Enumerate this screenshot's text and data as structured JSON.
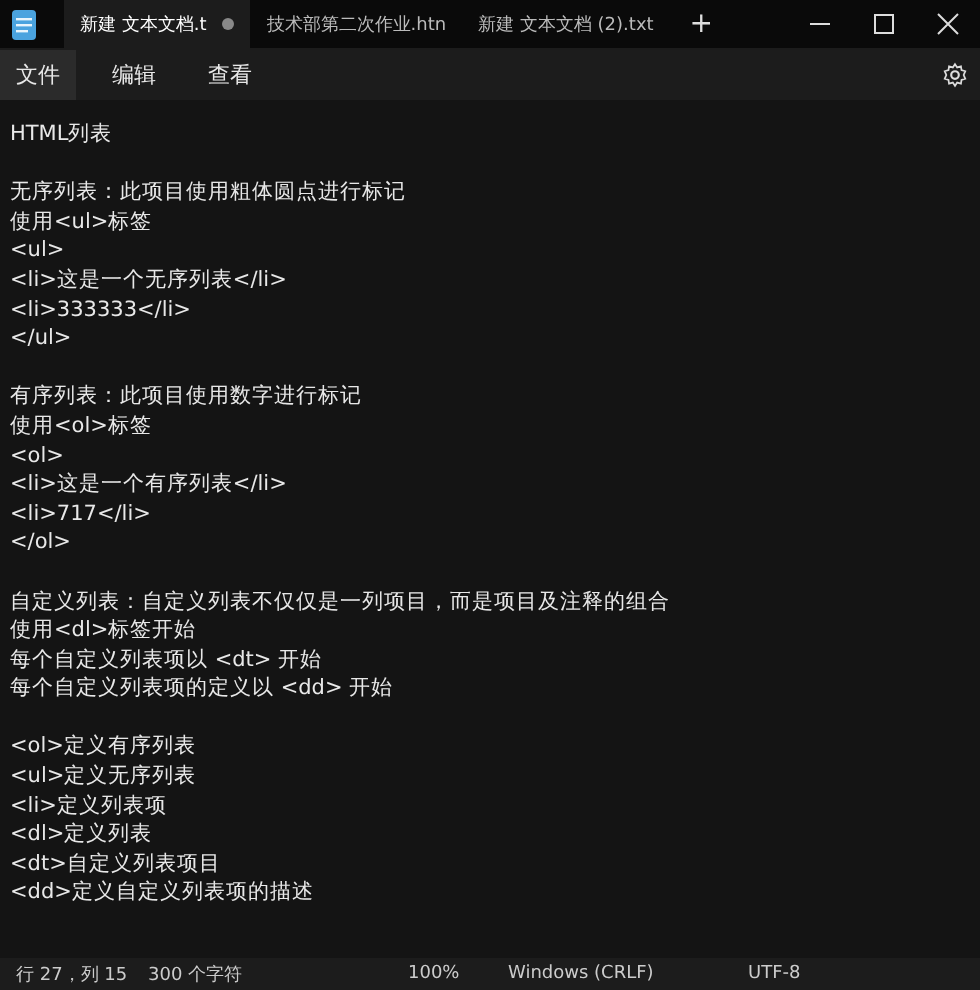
{
  "tabs": [
    {
      "label": "新建 文本文档.t",
      "selected": true,
      "modified": true
    },
    {
      "label": "技术部第二次作业.htn",
      "selected": false,
      "modified": false
    },
    {
      "label": "新建 文本文档 (2).txt",
      "selected": false,
      "modified": false
    }
  ],
  "new_tab": "+",
  "menu": [
    {
      "label": "文件",
      "selected": true
    },
    {
      "label": "编辑",
      "selected": false
    },
    {
      "label": "查看",
      "selected": false
    }
  ],
  "document": {
    "blocks": [
      {
        "lines": [
          "HTML列表"
        ]
      },
      {
        "lines": [
          "无序列表：此项目使用粗体圆点进行标记",
          "使用<ul>标签",
          "<ul>",
          "<li>这是一个无序列表</li>",
          "<li>333333</li>",
          "</ul>"
        ]
      },
      {
        "lines": [
          "有序列表：此项目使用数字进行标记",
          "使用<ol>标签",
          "<ol>",
          "<li>这是一个有序列表</li>",
          "<li>717</li>",
          "</ol>"
        ]
      },
      {
        "lines": [
          "自定义列表：自定义列表不仅仅是一列项目，而是项目及注释的组合",
          "使用<dl>标签开始",
          "每个自定义列表项以 <dt> 开始",
          "每个自定义列表项的定义以 <dd> 开始"
        ]
      },
      {
        "lines": [
          "<ol>定义有序列表",
          "<ul>定义无序列表",
          "<li>定义列表项",
          "<dl>定义列表",
          "<dt>自定义列表项目",
          "<dd>定义自定义列表项的描述"
        ]
      }
    ]
  },
  "status_bar": {
    "position": "行 27，列 15",
    "characters": "300 个字符",
    "zoom": "100%",
    "line_ending": "Windows (CRLF)",
    "encoding": "UTF-8"
  }
}
